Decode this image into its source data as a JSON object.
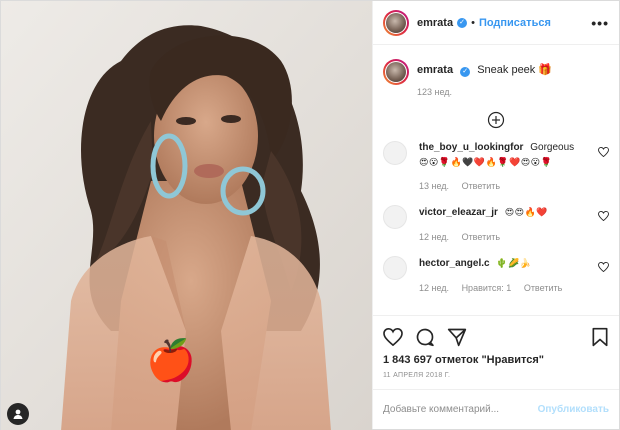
{
  "post": {
    "username": "emrata",
    "follow_label": "Подписаться",
    "dot": "•",
    "more_label": "•••",
    "caption": {
      "username": "emrata",
      "text": "Sneak peek 🎁",
      "age": "123 нед."
    },
    "comments": [
      {
        "username": "the_boy_u_lookingfor",
        "text": "Gorgeous",
        "emoji": "😍😮🌹🔥🖤❤️🔥🌹❤️😍😮🌹",
        "age": "13 нед.",
        "reply": "Ответить",
        "likes": ""
      },
      {
        "username": "victor_eleazar_jr",
        "text": "",
        "emoji": "😍😍🔥❤️",
        "age": "12 нед.",
        "reply": "Ответить",
        "likes": ""
      },
      {
        "username": "hector_angel.c",
        "text": "",
        "emoji": "🌵🌽🍌",
        "age": "12 нед.",
        "reply": "Ответить",
        "likes": "Нравится: 1"
      }
    ],
    "likes_text": "1 843 697 отметок \"Нравится\"",
    "date": "11 АПРЕЛЯ 2018 Г.",
    "add_comment_placeholder": "Добавьте комментарий...",
    "publish_label": "Опубликовать",
    "overlay_emoji": "🍎",
    "colors": {
      "link": "#3897f0",
      "muted": "#8e8e8e",
      "publish_disabled": "#b2dffc"
    },
    "icons": [
      "heart-icon",
      "comment-icon",
      "share-icon",
      "bookmark-icon",
      "plus-circle-icon",
      "tag-user-icon"
    ]
  }
}
